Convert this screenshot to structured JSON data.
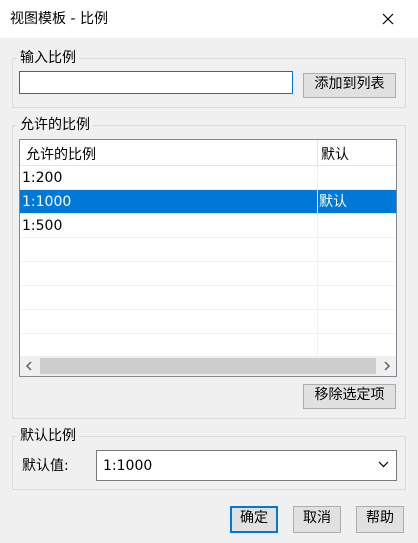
{
  "window": {
    "title": "视图模板 - 比例",
    "close_glyph": "✕"
  },
  "input_group": {
    "legend": "输入比例",
    "input_value": "",
    "input_placeholder": "",
    "add_button": "添加到列表"
  },
  "allowed_group": {
    "legend": "允许的比例",
    "columns": [
      "允许的比例",
      "默认"
    ],
    "rows": [
      {
        "ratio": "1:200",
        "default": ""
      },
      {
        "ratio": "1:1000",
        "default": "默认"
      },
      {
        "ratio": "1:500",
        "default": ""
      },
      {
        "ratio": "",
        "default": ""
      },
      {
        "ratio": "",
        "default": ""
      },
      {
        "ratio": "",
        "default": ""
      },
      {
        "ratio": "",
        "default": ""
      },
      {
        "ratio": "",
        "default": ""
      }
    ],
    "selected_row": 1,
    "scroll_left": "‹",
    "scroll_right": "›",
    "remove_button": "移除选定项"
  },
  "default_group": {
    "legend": "默认比例",
    "label": "默认值:",
    "selected_value": "1:1000"
  },
  "buttons": {
    "ok": "确定",
    "cancel": "取消",
    "help": "帮助"
  },
  "colors": {
    "accent": "#0078d7",
    "selection": "#0078d7",
    "background": "#f0f0f0"
  }
}
